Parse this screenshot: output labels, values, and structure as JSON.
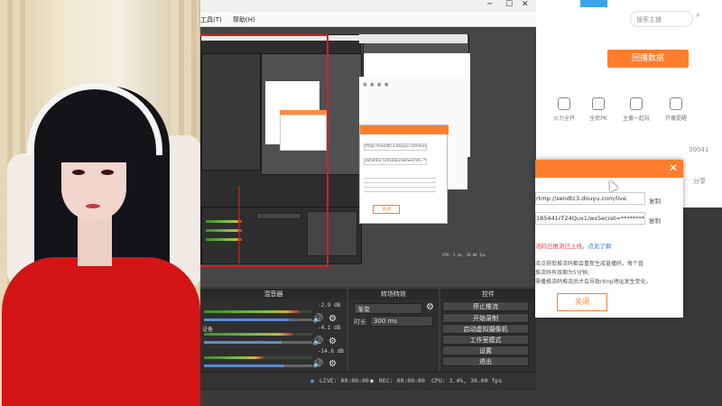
{
  "obs": {
    "menu": [
      "工具(T)",
      "帮助(H)"
    ],
    "docks": {
      "mixer": "混音器",
      "transitions": "转场特效",
      "controls": "控件"
    },
    "mixer": {
      "tracks": [
        {
          "label": "",
          "db": "-2.9 dB",
          "level": 0.88,
          "volume": 0.78
        },
        {
          "label": "设备",
          "db": "-4.1 dB",
          "level": 0.82,
          "volume": 0.72
        },
        {
          "label": "",
          "db": "-14.6 dB",
          "level": 0.55,
          "volume": 0.74
        }
      ]
    },
    "transitions": {
      "type": "渐变",
      "duration_label": "时长",
      "duration": "300 ms"
    },
    "controls": [
      "停止推流",
      "开始录制",
      "启动虚拟摄像机",
      "工作室模式",
      "设置",
      "退出"
    ],
    "status": {
      "live": "LIVE: 00:00:00",
      "rec": "REC: 00:00:00",
      "cpu": "CPU: 3.4%, 30.00 fps"
    }
  },
  "webpage": {
    "search_placeholder": "搜索主播",
    "primary_button": "回播数据",
    "features": [
      "火力全开",
      "全民PK",
      "主播一起玩",
      "开播提醒"
    ],
    "count": "30041",
    "share": "分享"
  },
  "dialog": {
    "server_url": "rtmp://sendtc3.douyu.com/live",
    "stream_key": "185441rT24Qux1/wsSecret=*********",
    "copy_label": "复制",
    "warning": "流码已推流已上线，",
    "warning_link": "点此了解",
    "note1": "流点获取推流码都会重新生成直播码，每个直",
    "note2": "推流码有效期为5分钟。",
    "note3": "需播推流码推流后才会导致rtmp地址发生变化。",
    "close_button": "关闭"
  },
  "nested": {
    "url": "rtmp://sendtc3.douyu.com/live",
    "key": "185441rT24Qux1/wsSecret=***",
    "btn": "关闭",
    "cpu": "CPU: 3.4%, 30.00 fps"
  }
}
